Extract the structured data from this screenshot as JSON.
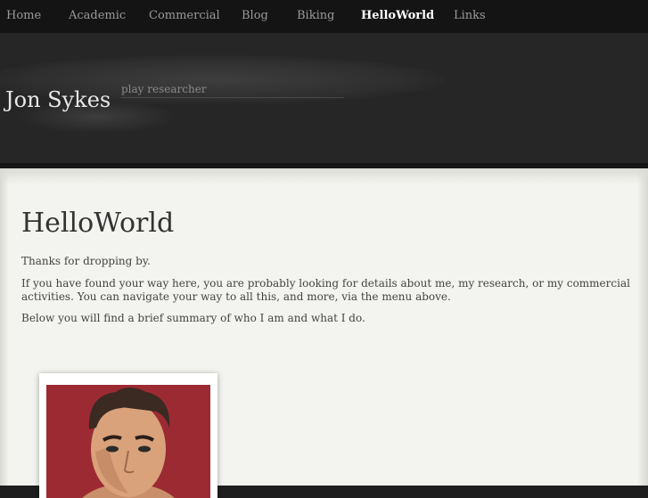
{
  "nav": {
    "items": [
      {
        "label": "Home"
      },
      {
        "label": "Academic"
      },
      {
        "label": "Commercial"
      },
      {
        "label": "Blog"
      },
      {
        "label": "Biking"
      },
      {
        "label": "HelloWorld"
      },
      {
        "label": "Links"
      }
    ],
    "active": "HelloWorld"
  },
  "header": {
    "site_title": "Jon Sykes",
    "tagline": "play researcher"
  },
  "main": {
    "title": "HelloWorld",
    "paragraphs": [
      "Thanks for dropping by.",
      "If you have found your way here, you are probably looking for details about me, my research, or my commercial activities. You can navigate your way to all this, and more, via the menu above.",
      "Below you will find a brief summary of who I am and what I do."
    ]
  },
  "colors": {
    "nav_bg": "#141414",
    "header_bg": "#262626",
    "content_bg": "#f3f3ef",
    "photo_bg": "#9c2a33"
  }
}
